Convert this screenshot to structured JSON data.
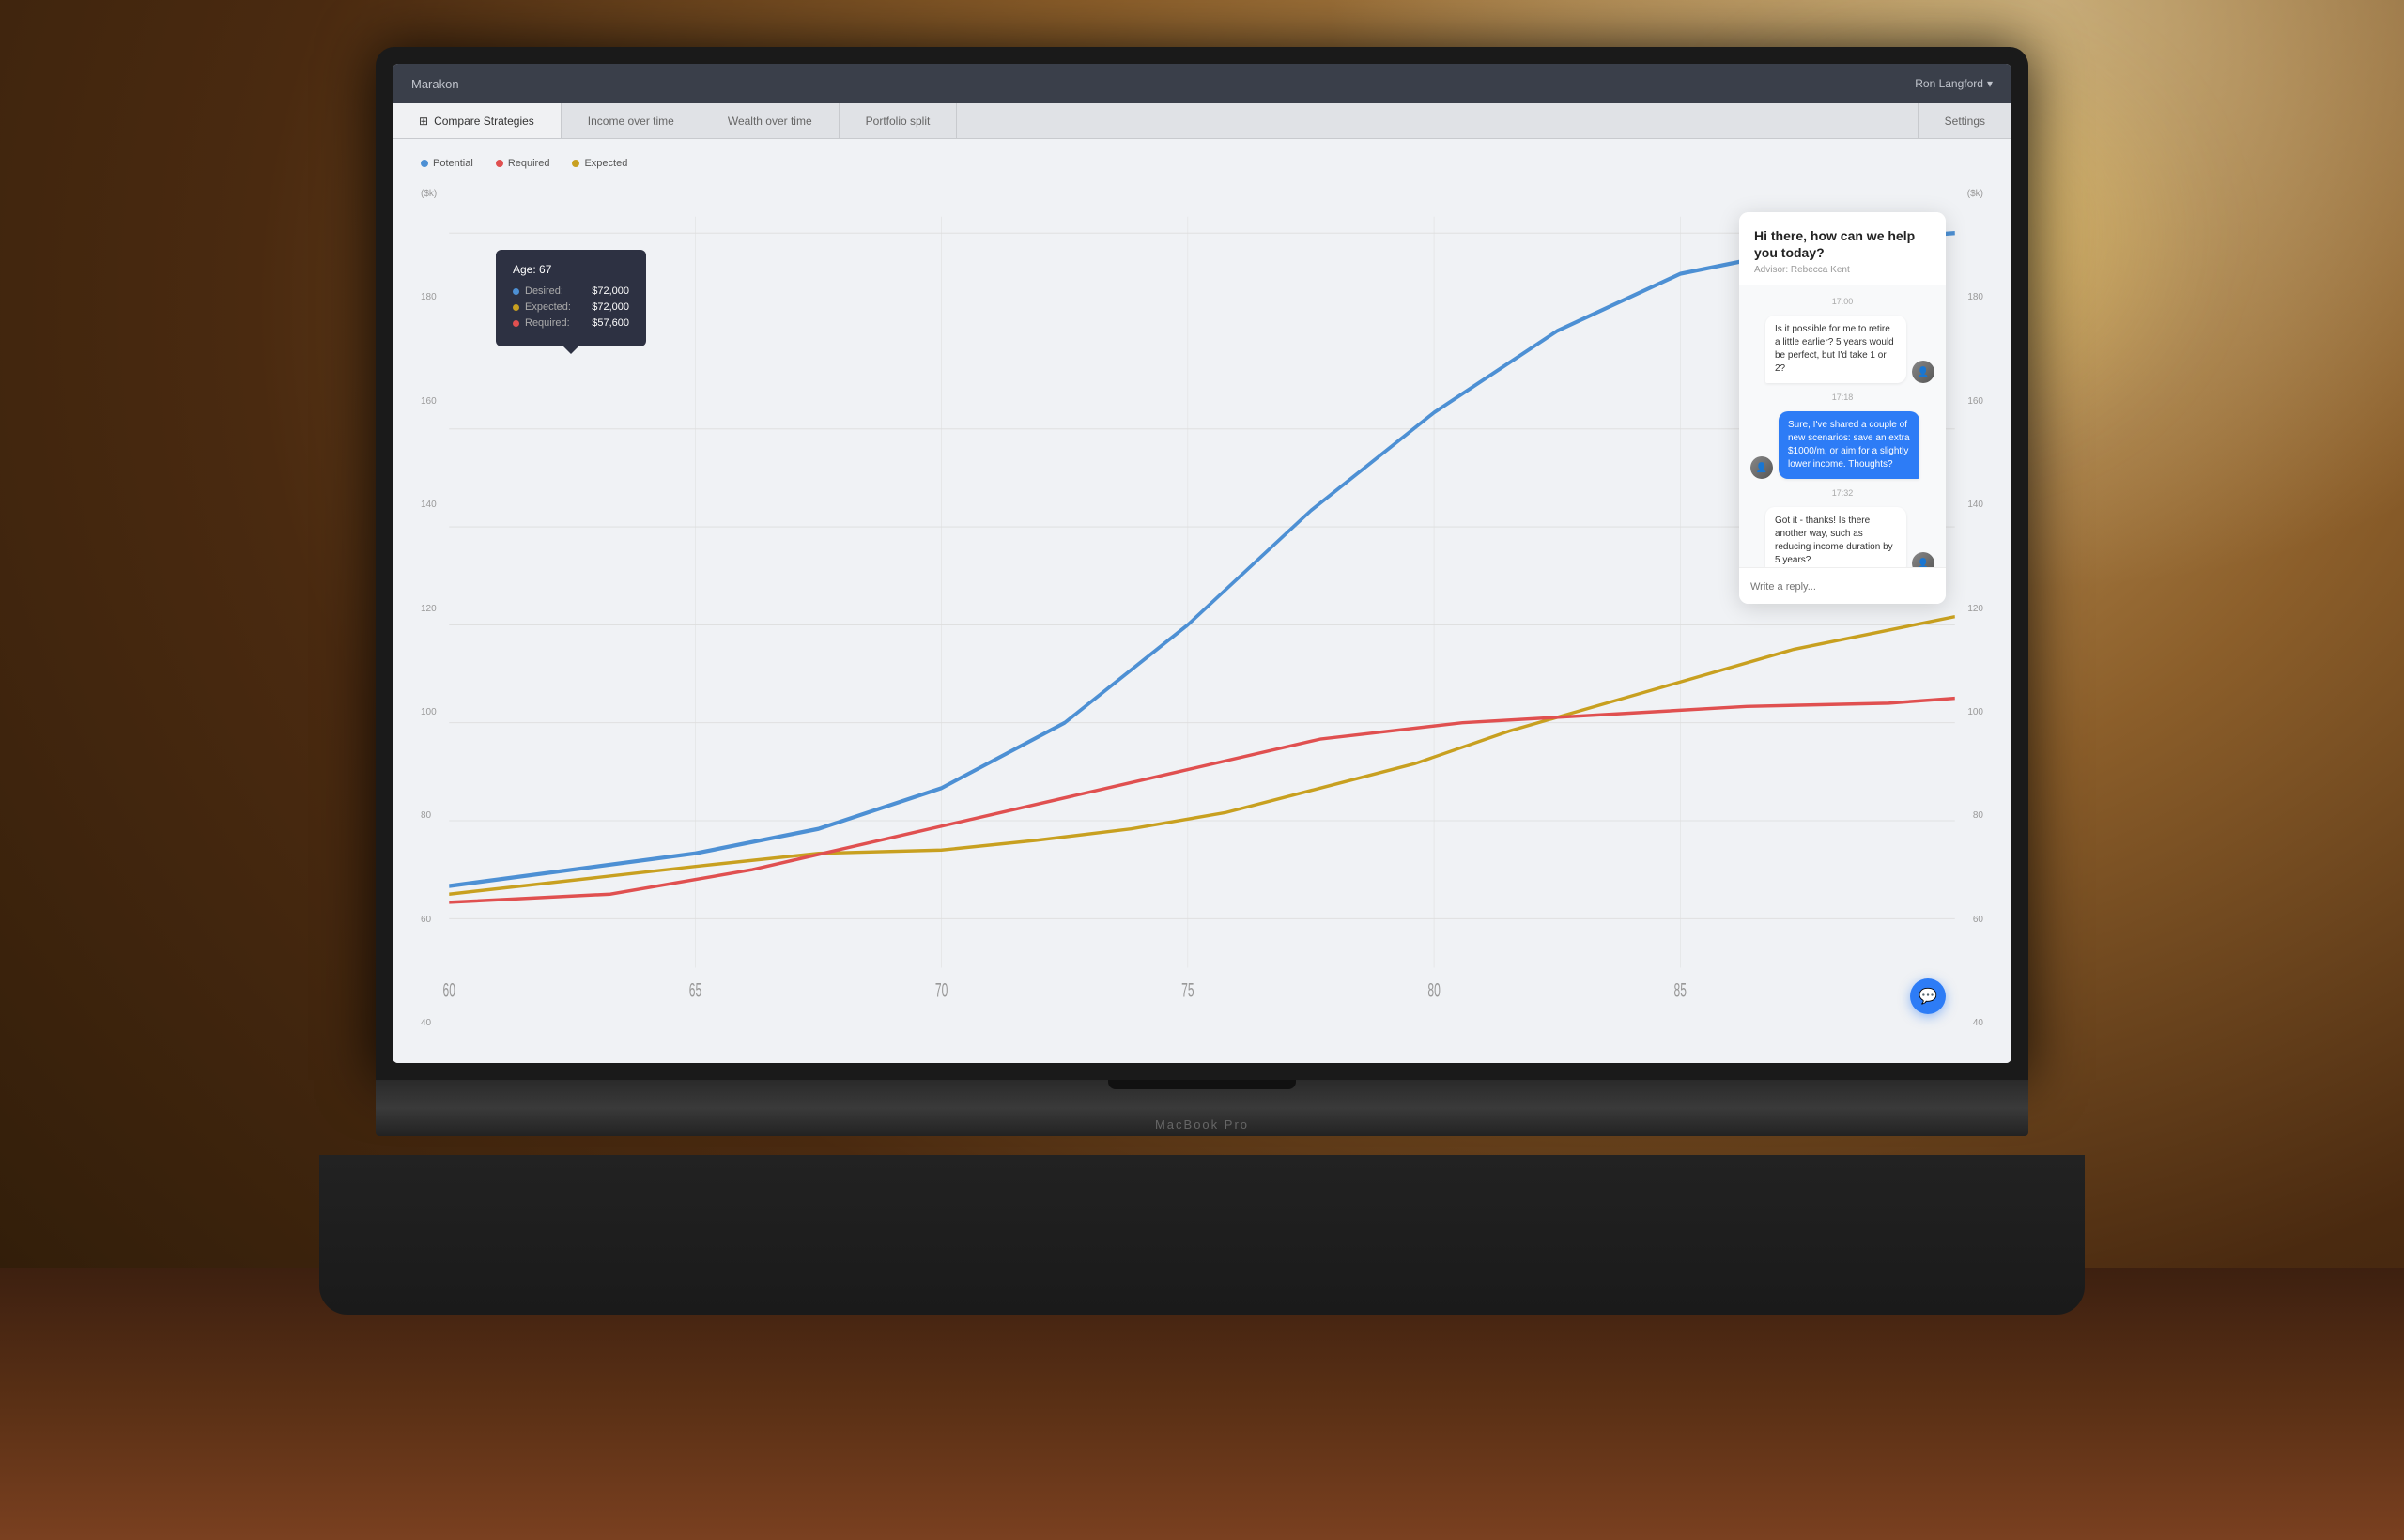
{
  "app": {
    "title": "Marakon",
    "user": "Ron Langford",
    "tabs": [
      {
        "id": "compare",
        "label": "Compare Strategies",
        "active": true,
        "icon": "compare"
      },
      {
        "id": "income",
        "label": "Income over time",
        "active": false
      },
      {
        "id": "wealth",
        "label": "Wealth over time",
        "active": false
      },
      {
        "id": "portfolio",
        "label": "Portfolio split",
        "active": false
      },
      {
        "id": "settings",
        "label": "Settings",
        "active": false,
        "right": true
      }
    ]
  },
  "chart": {
    "legend": [
      {
        "label": "Potential",
        "color": "#4d90d4"
      },
      {
        "label": "Required",
        "color": "#e05050"
      },
      {
        "label": "Expected",
        "color": "#c8a020"
      }
    ],
    "y_axis_left": [
      "($k)",
      "180",
      "160",
      "140",
      "120",
      "100",
      "80",
      "60",
      "40"
    ],
    "y_axis_right": [
      "($k)",
      "180",
      "160",
      "140",
      "120",
      "100",
      "80",
      "60",
      "40"
    ],
    "x_axis": [
      "60",
      "65",
      "70",
      "75",
      "80",
      "85"
    ],
    "tooltip": {
      "age_label": "Age:",
      "age_value": "67",
      "rows": [
        {
          "label": "Desired:",
          "value": "$72,000",
          "color": "#4d90d4"
        },
        {
          "label": "Expected:",
          "value": "$72,000",
          "color": "#c8a020"
        },
        {
          "label": "Required:",
          "value": "$57,600",
          "color": "#e05050"
        }
      ]
    }
  },
  "chat": {
    "greeting": "Hi there, how can we help you today?",
    "advisor_label": "Advisor: Rebecca Kent",
    "messages": [
      {
        "time": "17:00",
        "sender": "user",
        "text": "Is it possible for me to retire a little earlier? 5 years would be perfect, but I'd take 1 or 2?"
      },
      {
        "time": "17:18",
        "sender": "advisor",
        "text": "Sure, I've shared a couple of new scenarios: save an extra $1000/m, or aim for a slightly lower income. Thoughts?"
      },
      {
        "time": "17:32",
        "sender": "user",
        "text": "Got it - thanks! Is there another way, such as reducing income duration by 5 years?"
      }
    ],
    "input_placeholder": "Write a reply...",
    "fab_icon": "💬"
  },
  "macbook": {
    "label": "MacBook Pro"
  }
}
